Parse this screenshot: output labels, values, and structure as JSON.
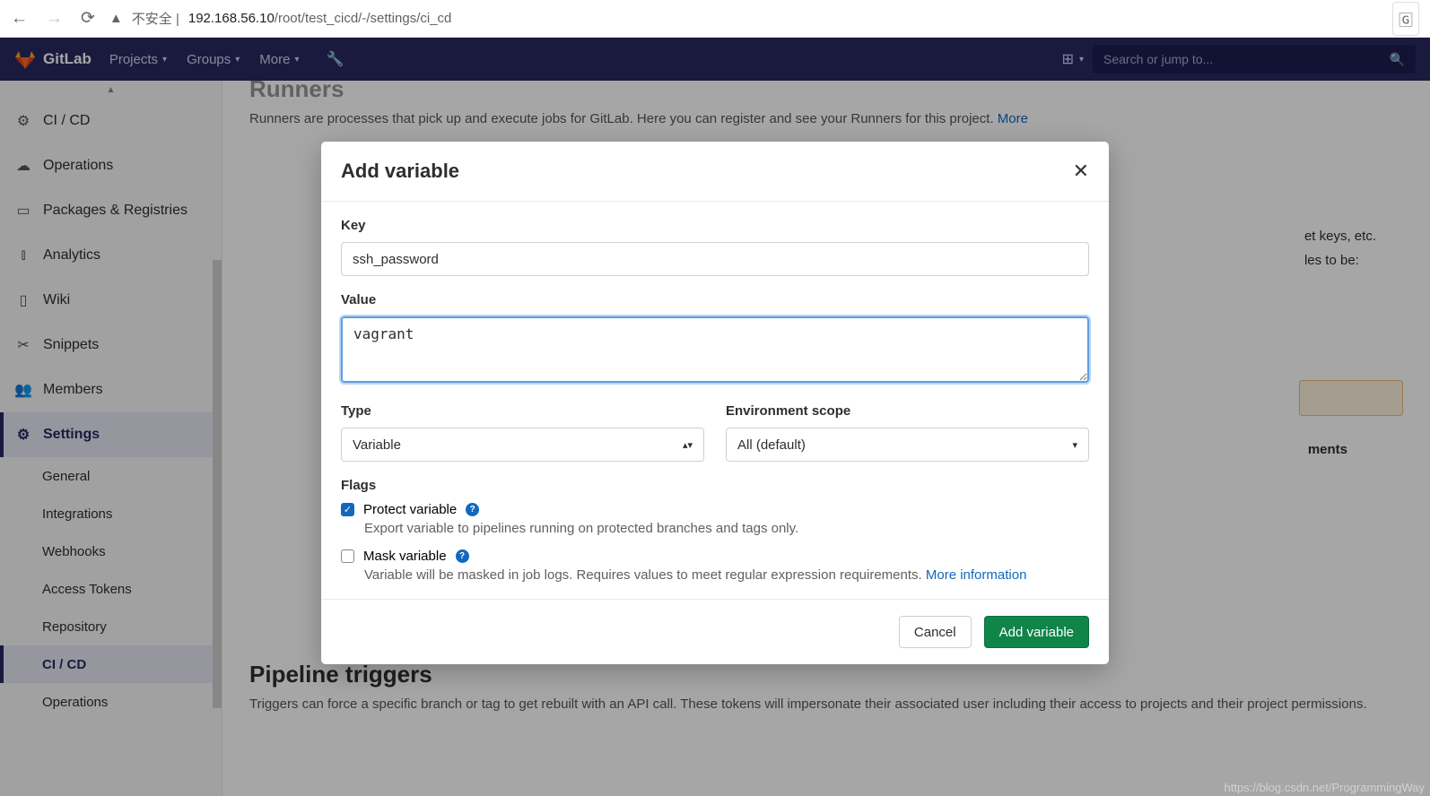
{
  "browser": {
    "insecure_label": "不安全 |",
    "url_host": "192.168.56.10",
    "url_path": "/root/test_cicd/-/settings/ci_cd"
  },
  "topnav": {
    "brand": "GitLab",
    "projects": "Projects",
    "groups": "Groups",
    "more": "More",
    "search_placeholder": "Search or jump to..."
  },
  "sidebar": {
    "items": [
      {
        "label": "CI / CD",
        "icon": "rocket"
      },
      {
        "label": "Operations",
        "icon": "cloud"
      },
      {
        "label": "Packages & Registries",
        "icon": "package"
      },
      {
        "label": "Analytics",
        "icon": "chart"
      },
      {
        "label": "Wiki",
        "icon": "book"
      },
      {
        "label": "Snippets",
        "icon": "scissors"
      },
      {
        "label": "Members",
        "icon": "users"
      },
      {
        "label": "Settings",
        "icon": "gear"
      }
    ],
    "settings_sub": [
      "General",
      "Integrations",
      "Webhooks",
      "Access Tokens",
      "Repository",
      "CI / CD",
      "Operations"
    ]
  },
  "page": {
    "runners_title": "Runners",
    "runners_more": "More",
    "variables_line1_tail": "et keys, etc.",
    "variables_line2_tail": "les to be:",
    "environments_tail": "ments",
    "pipeline_title": "Pipeline triggers",
    "pipeline_desc": "Triggers can force a specific branch or tag to get rebuilt with an API call. These tokens will impersonate their associated user including their access to projects and their project permissions."
  },
  "modal": {
    "title": "Add variable",
    "key_label": "Key",
    "key_value": "ssh_password",
    "value_label": "Value",
    "value_value": "vagrant",
    "type_label": "Type",
    "type_selected": "Variable",
    "scope_label": "Environment scope",
    "scope_selected": "All (default)",
    "flags_label": "Flags",
    "protect_label": "Protect variable",
    "protect_desc": "Export variable to pipelines running on protected branches and tags only.",
    "mask_label": "Mask variable",
    "mask_desc": "Variable will be masked in job logs. Requires values to meet regular expression requirements. ",
    "mask_more": "More information",
    "cancel": "Cancel",
    "submit": "Add variable"
  },
  "watermark": "https://blog.csdn.net/ProgrammingWay"
}
